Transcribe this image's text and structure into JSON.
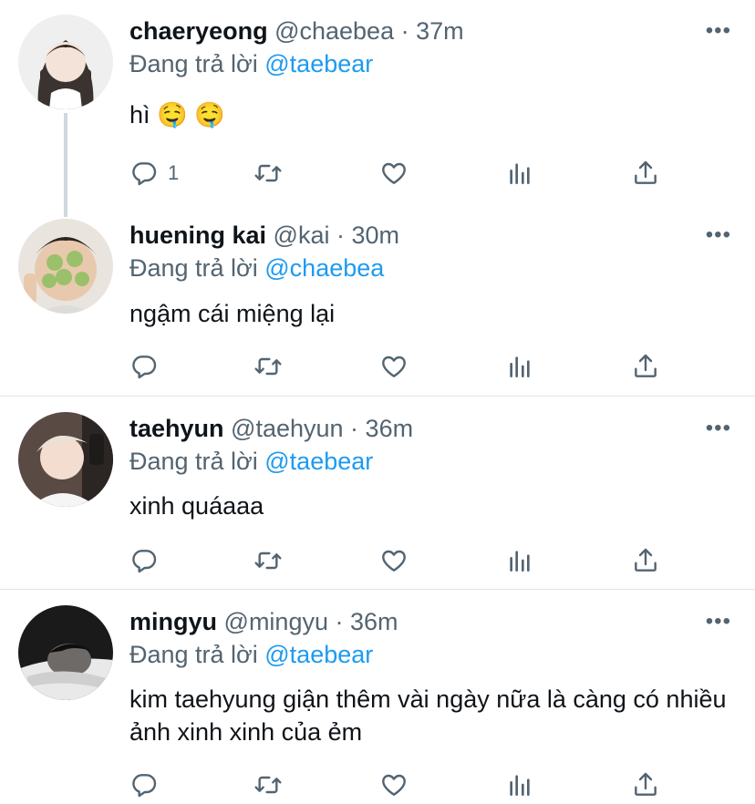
{
  "tweets": [
    {
      "name": "chaeryeong",
      "handle": "@chaebea",
      "time": "37m",
      "reply_prefix": "Đang trả lời ",
      "reply_to": "@taebear",
      "text": "hì 🤤 🤤",
      "reply_count": "1"
    },
    {
      "name": "huening kai",
      "handle": "@kai",
      "time": "30m",
      "reply_prefix": "Đang trả lời ",
      "reply_to": "@chaebea",
      "text": "ngậm cái miệng lại",
      "reply_count": ""
    },
    {
      "name": "taehyun",
      "handle": "@taehyun",
      "time": "36m",
      "reply_prefix": "Đang trả lời ",
      "reply_to": "@taebear",
      "text": "xinh quáaaa",
      "reply_count": ""
    },
    {
      "name": "mingyu",
      "handle": "@mingyu",
      "time": "36m",
      "reply_prefix": "Đang trả lời ",
      "reply_to": "@taebear",
      "text": "kim taehyung giận thêm vài ngày nữa là càng có nhiều ảnh xinh xinh của ẻm",
      "reply_count": ""
    }
  ],
  "separator": " · ",
  "more_glyph": "•••",
  "colors": {
    "accent": "#1d9bf0",
    "muted": "#536471",
    "text": "#0f1419",
    "divider": "#dfe3e6"
  },
  "icons": [
    "reply-icon",
    "retweet-icon",
    "like-icon",
    "analytics-icon",
    "share-icon",
    "more-icon"
  ]
}
